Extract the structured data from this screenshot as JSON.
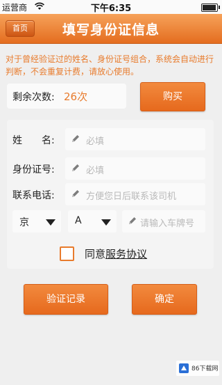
{
  "status_bar": {
    "carrier": "运营商",
    "time": "下午6:35",
    "battery_level": 0.95
  },
  "navbar": {
    "back_label": "首页",
    "title": "填写身份证信息"
  },
  "notice": "对于曾经验证过的姓名、身份证号组合，系统会自动进行判断，不会重复计费，请放心使用。",
  "remaining": {
    "label": "剩余次数:",
    "count": "26次",
    "buy_label": "购买"
  },
  "form": {
    "name_label": "姓　　名:",
    "name_placeholder": "必填",
    "id_label": "身份证号:",
    "id_placeholder": "必填",
    "phone_label": "联系电话:",
    "phone_placeholder": "方便您日后联系该司机",
    "province_value": "京",
    "letter_value": "A",
    "plate_placeholder": "请输入车牌号"
  },
  "agreement": {
    "prefix": "同意",
    "link": "服务协议",
    "checked": false
  },
  "actions": {
    "record_label": "验证记录",
    "confirm_label": "确定"
  },
  "watermark": "86下载网",
  "colors": {
    "accent": "#e8711f",
    "notice_text": "#e87b2c"
  }
}
